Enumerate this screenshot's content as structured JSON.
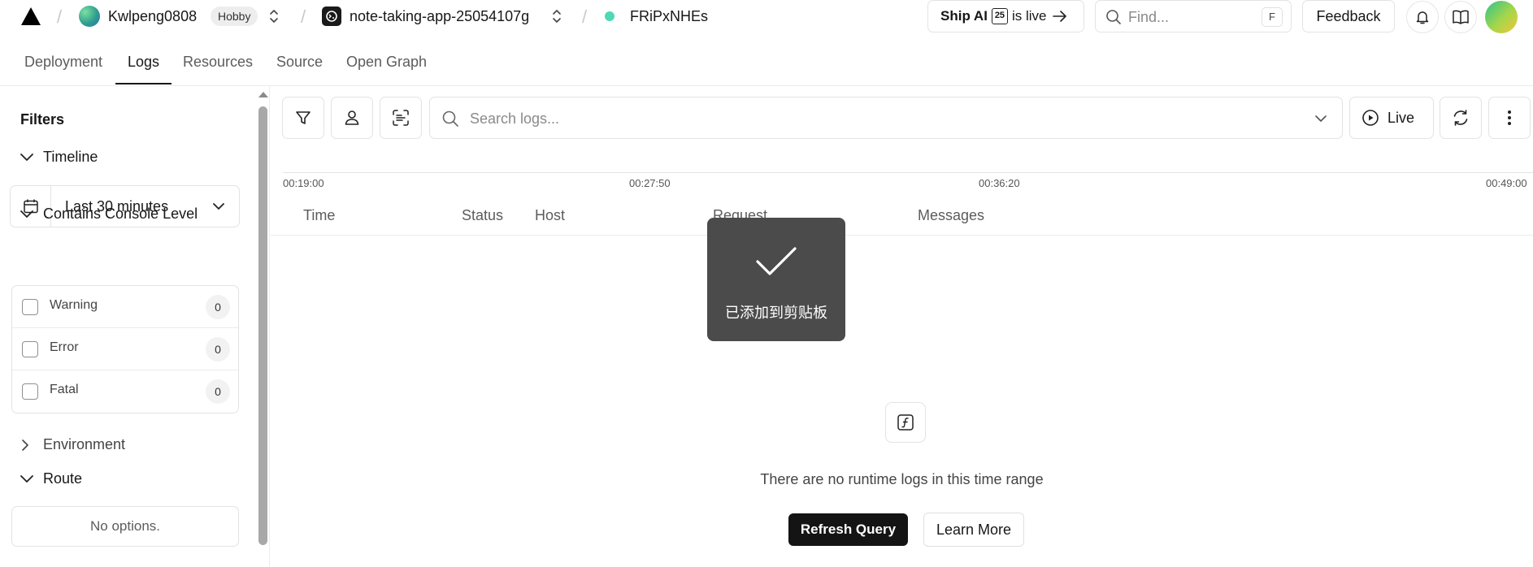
{
  "header": {
    "team_name": "Kwlpeng0808",
    "plan_badge": "Hobby",
    "project_name": "note-taking-app-25054107g",
    "deployment_id": "FRiPxNHEs",
    "status_color": "#4fd8b6",
    "ship_ai": {
      "bold": "Ship AI",
      "badge": "25",
      "rest": "is live"
    },
    "search_placeholder": "Find...",
    "search_shortcut": "F",
    "feedback_label": "Feedback",
    "icons": [
      "triangle-logo-icon",
      "bell-icon",
      "book-icon"
    ]
  },
  "tabs": [
    {
      "label": "Deployment",
      "active": false
    },
    {
      "label": "Logs",
      "active": true
    },
    {
      "label": "Resources",
      "active": false
    },
    {
      "label": "Source",
      "active": false
    },
    {
      "label": "Open Graph",
      "active": false
    }
  ],
  "sidebar": {
    "title": "Filters",
    "timeline": {
      "label": "Timeline",
      "value": "Last 30 minutes"
    },
    "console_level": {
      "label": "Contains Console Level",
      "levels": [
        {
          "label": "Warning",
          "count": "0"
        },
        {
          "label": "Error",
          "count": "0"
        },
        {
          "label": "Fatal",
          "count": "0"
        }
      ]
    },
    "environment_label": "Environment",
    "route": {
      "label": "Route",
      "empty": "No options."
    }
  },
  "toolbar": {
    "search_placeholder": "Search logs...",
    "live_label": "Live",
    "icons": [
      "filter-icon",
      "user-icon",
      "scan-icon",
      "refresh-icon",
      "more-icon"
    ]
  },
  "timeline_axis": [
    "00:19:00",
    "00:27:50",
    "00:36:20",
    "00:49:00"
  ],
  "table": {
    "columns": [
      "Time",
      "Status",
      "Host",
      "Request",
      "Messages"
    ]
  },
  "toast": {
    "text": "已添加到剪贴板"
  },
  "empty_state": {
    "message": "There are no runtime logs in this time range",
    "refresh_label": "Refresh Query",
    "learn_label": "Learn More"
  }
}
